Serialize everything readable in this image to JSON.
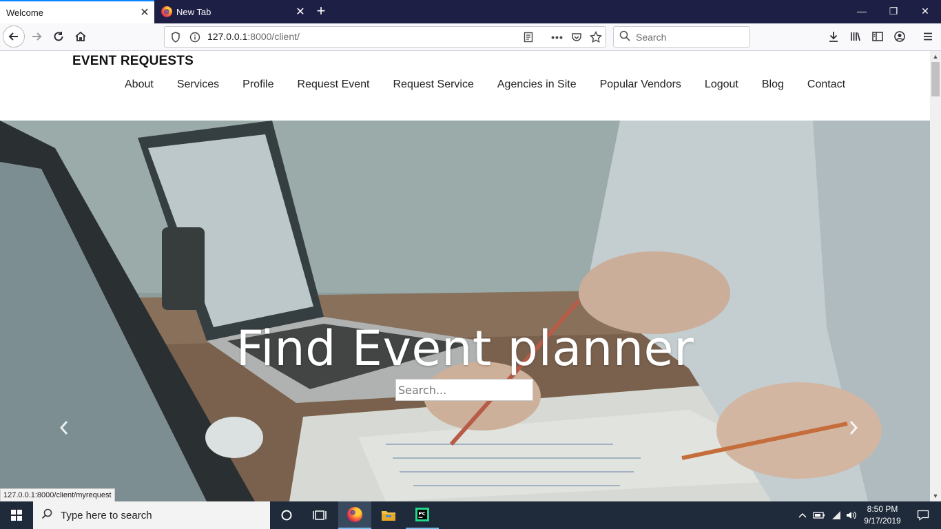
{
  "browser": {
    "tabs": [
      {
        "label": "Welcome",
        "active": true
      },
      {
        "label": "New Tab",
        "active": false
      }
    ],
    "url": {
      "host": "127.0.0.1",
      "rest": ":8000/client/"
    },
    "search_placeholder": "Search",
    "status_url": "127.0.0.1:8000/client/myrequest"
  },
  "site": {
    "brand": "EVENT REQUESTS",
    "nav": [
      "About",
      "Services",
      "Profile",
      "Request Event",
      "Request Service",
      "Agencies in Site",
      "Popular Vendors",
      "Logout",
      "Blog",
      "Contact"
    ],
    "hero": {
      "title": "Find Event planner",
      "search_placeholder": "Search..."
    }
  },
  "taskbar": {
    "search_placeholder": "Type here to search",
    "time": "8:50 PM",
    "date": "9/17/2019"
  },
  "colors": {
    "tabbar": "#1e1f44",
    "accent": "#0a84ff",
    "taskbar": "#1f2b3a"
  }
}
